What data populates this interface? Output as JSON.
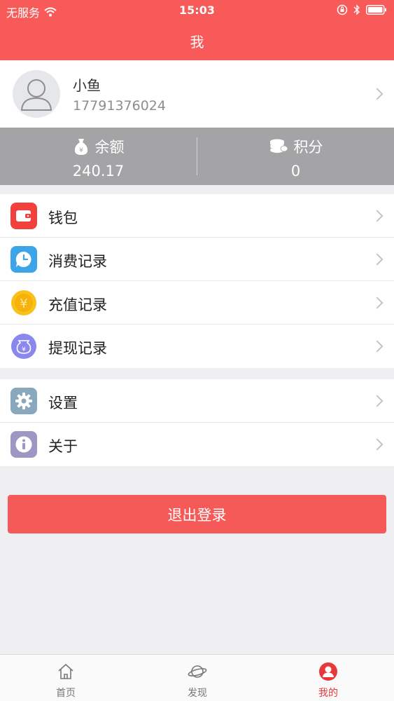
{
  "status_bar": {
    "carrier": "无服务",
    "time": "15:03"
  },
  "nav": {
    "title": "我"
  },
  "profile": {
    "name": "小鱼",
    "phone": "17791376024"
  },
  "stats": {
    "balance_label": "余额",
    "balance_value": "240.17",
    "points_label": "积分",
    "points_value": "0"
  },
  "menu_group_1": [
    {
      "label": "钱包",
      "icon": "wallet-icon",
      "color": "#f2413c"
    },
    {
      "label": "消费记录",
      "icon": "clock-chat-icon",
      "color": "#3ea4e8"
    },
    {
      "label": "充值记录",
      "icon": "yen-coin-icon",
      "color": "#f8c21b"
    },
    {
      "label": "提现记录",
      "icon": "yen-bag-icon",
      "color": "#8a87ef"
    }
  ],
  "menu_group_2": [
    {
      "label": "设置",
      "icon": "gear-icon",
      "color": "#8aa8bd"
    },
    {
      "label": "关于",
      "icon": "info-icon",
      "color": "#9e97c4"
    }
  ],
  "logout_label": "退出登录",
  "tabbar": {
    "items": [
      {
        "label": "首页",
        "icon": "home-icon",
        "active": false
      },
      {
        "label": "发现",
        "icon": "planet-icon",
        "active": false
      },
      {
        "label": "我的",
        "icon": "user-icon",
        "active": true
      }
    ]
  },
  "colors": {
    "primary": "#f85a5a",
    "stats_bg": "#a4a4a6",
    "active_tab": "#e8393a"
  }
}
